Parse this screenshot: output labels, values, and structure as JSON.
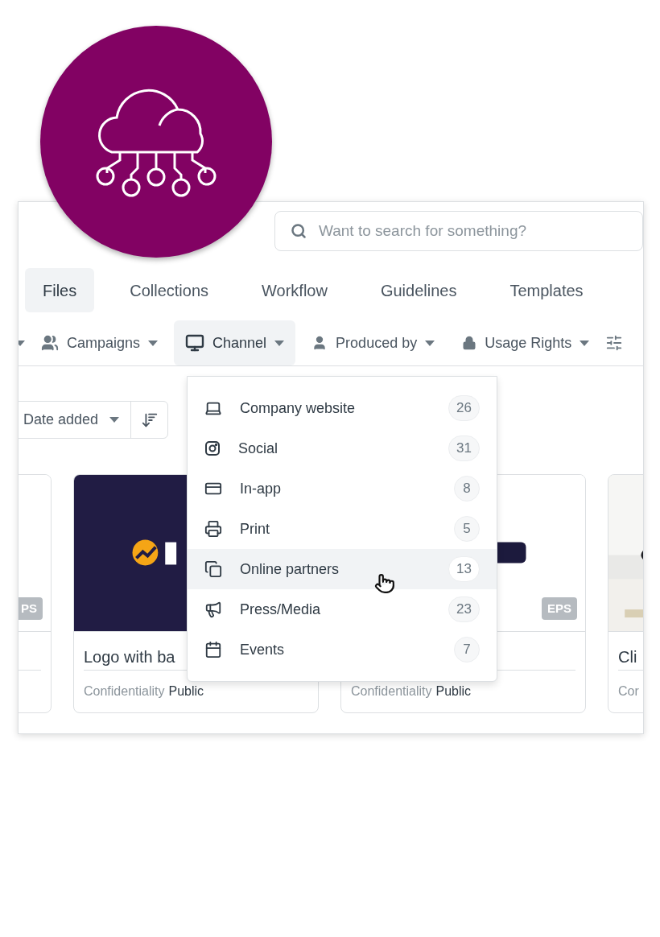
{
  "search": {
    "placeholder": "Want to search for something?"
  },
  "tabs": [
    {
      "label": "Files",
      "selected": true
    },
    {
      "label": "Collections",
      "selected": false
    },
    {
      "label": "Workflow",
      "selected": false
    },
    {
      "label": "Guidelines",
      "selected": false
    },
    {
      "label": "Templates",
      "selected": false
    }
  ],
  "filters": [
    {
      "label": "Campaigns",
      "open": false
    },
    {
      "label": "Channel",
      "open": true
    },
    {
      "label": "Produced by",
      "open": false
    },
    {
      "label": "Usage Rights",
      "open": false
    }
  ],
  "sort": {
    "label": "Date added"
  },
  "cards": [
    {
      "kind": "blank",
      "badge": "PS"
    },
    {
      "kind": "dark",
      "title": "Logo with ba",
      "meta_label": "Confidentiality",
      "meta_value": "Public"
    },
    {
      "kind": "light",
      "badge": "EPS",
      "meta_label": "Confidentiality",
      "meta_value": "Public"
    },
    {
      "title": "Cli",
      "meta_label": "Cor"
    }
  ],
  "dropdown": {
    "items": [
      {
        "label": "Company website",
        "count": "26",
        "hovered": false
      },
      {
        "label": "Social",
        "count": "31",
        "hovered": false
      },
      {
        "label": "In-app",
        "count": "8",
        "hovered": false
      },
      {
        "label": "Print",
        "count": "5",
        "hovered": false
      },
      {
        "label": "Online partners",
        "count": "13",
        "hovered": true
      },
      {
        "label": "Press/Media",
        "count": "23",
        "hovered": false
      },
      {
        "label": "Events",
        "count": "7",
        "hovered": false
      }
    ]
  }
}
